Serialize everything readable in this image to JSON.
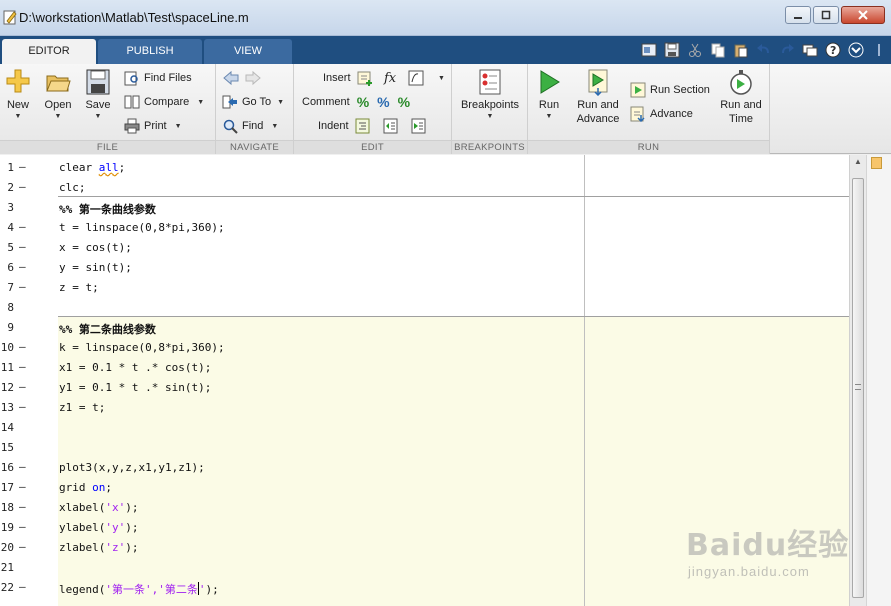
{
  "window": {
    "title": "D:\\workstation\\Matlab\\Test\\spaceLine.m",
    "minimize": "▭",
    "restore": "▢",
    "close": "✕"
  },
  "tabs": [
    {
      "label": "EDITOR",
      "active": true
    },
    {
      "label": "PUBLISH",
      "active": false
    },
    {
      "label": "VIEW",
      "active": false
    }
  ],
  "ribbon": {
    "file": {
      "caption": "FILE",
      "new_label": "New",
      "open_label": "Open",
      "save_label": "Save",
      "find_files_label": "Find Files",
      "compare_label": "Compare",
      "print_label": "Print"
    },
    "navigate": {
      "caption": "NAVIGATE",
      "goto_label": "Go To",
      "find_label": "Find"
    },
    "edit": {
      "caption": "EDIT",
      "insert_label": "Insert",
      "comment_label": "Comment",
      "indent_label": "Indent",
      "fx_label": "fx"
    },
    "breakpoints": {
      "caption": "BREAKPOINTS",
      "breakpoints_label": "Breakpoints"
    },
    "run": {
      "caption": "RUN",
      "run_label": "Run",
      "run_and_advance_label_1": "Run and",
      "run_and_advance_label_2": "Advance",
      "run_section_label": "Run Section",
      "advance_label": "Advance",
      "run_and_time_label_1": "Run and",
      "run_and_time_label_2": "Time"
    }
  },
  "editor": {
    "lines": [
      {
        "n": "1",
        "exec": true
      },
      {
        "n": "2",
        "exec": true
      },
      {
        "n": "3",
        "exec": false
      },
      {
        "n": "4",
        "exec": true
      },
      {
        "n": "5",
        "exec": true
      },
      {
        "n": "6",
        "exec": true
      },
      {
        "n": "7",
        "exec": true
      },
      {
        "n": "8",
        "exec": false
      },
      {
        "n": "9",
        "exec": false
      },
      {
        "n": "10",
        "exec": true
      },
      {
        "n": "11",
        "exec": true
      },
      {
        "n": "12",
        "exec": true
      },
      {
        "n": "13",
        "exec": true
      },
      {
        "n": "14",
        "exec": false
      },
      {
        "n": "15",
        "exec": false
      },
      {
        "n": "16",
        "exec": true
      },
      {
        "n": "17",
        "exec": true
      },
      {
        "n": "18",
        "exec": true
      },
      {
        "n": "19",
        "exec": true
      },
      {
        "n": "20",
        "exec": true
      },
      {
        "n": "21",
        "exec": false
      },
      {
        "n": "22",
        "exec": true
      }
    ],
    "code": {
      "l1a": "clear ",
      "l1b": "all",
      "l1c": ";",
      "l2": "clc;",
      "l3": "%% 第一条曲线参数",
      "l4": "t = linspace(0,8*pi,360);",
      "l5": "x = cos(t);",
      "l6": "y = sin(t);",
      "l7": "z = t;",
      "l9": "%% 第二条曲线参数",
      "l10": "k = linspace(0,8*pi,360);",
      "l11": "x1 = 0.1 * t .* cos(t);",
      "l12": "y1 = 0.1 * t .* sin(t);",
      "l13": "z1 = t;",
      "l16": "plot3(x,y,z,x1,y1,z1);",
      "l17a": "grid ",
      "l17b": "on",
      "l17c": ";",
      "l18a": "xlabel(",
      "l18b": "'x'",
      "l18c": ");",
      "l19a": "ylabel(",
      "l19b": "'y'",
      "l19c": ");",
      "l20a": "zlabel(",
      "l20b": "'z'",
      "l20c": ");",
      "l22a": "legend(",
      "l22b": "'第一条','第二条",
      "l22c": "'",
      "l22d": ");"
    }
  },
  "watermark": {
    "logo": "Baidu经验",
    "url": "jingyan.baidu.com"
  },
  "colors": {
    "keyword": "#0000ff",
    "string": "#a020f0",
    "comment": "#228b22",
    "cell_highlight": "#fbfbe6",
    "tabstrip": "#1f4e80"
  }
}
